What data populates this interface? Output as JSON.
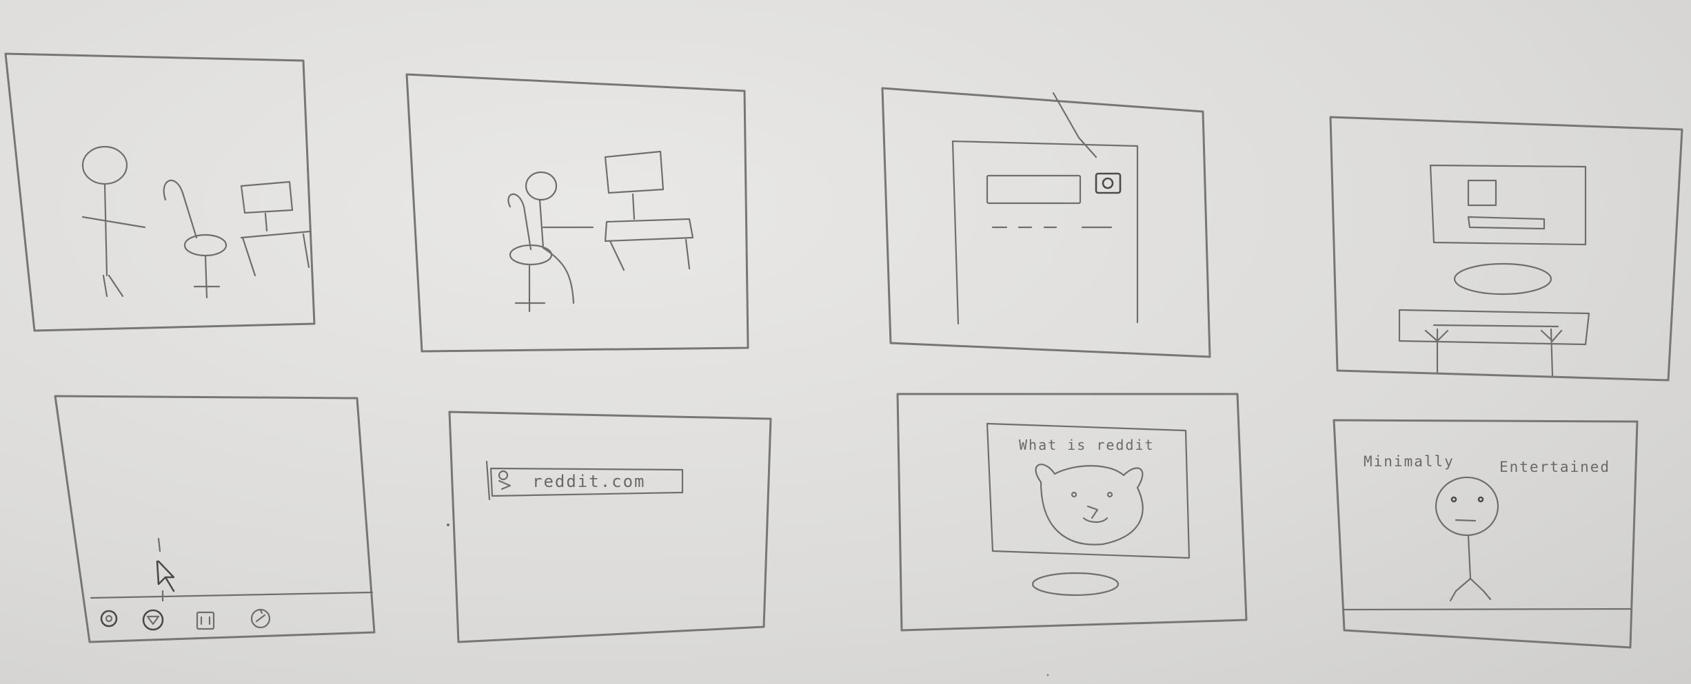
{
  "panels": [
    {
      "id": "panel-1"
    },
    {
      "id": "panel-2"
    },
    {
      "id": "panel-3"
    },
    {
      "id": "panel-4"
    },
    {
      "id": "panel-5"
    },
    {
      "id": "panel-6",
      "url_text": "reddit.com"
    },
    {
      "id": "panel-7",
      "screen_caption": "What is reddit"
    },
    {
      "id": "panel-8",
      "caption_left": "Minimally",
      "caption_right": "Entertained"
    }
  ],
  "icons": [
    "chair-icon",
    "desk-icon",
    "monitor-icon",
    "power-button-icon",
    "taskbar-icons",
    "browser-icon",
    "cat-face-icon",
    "stick-figure-icon"
  ]
}
